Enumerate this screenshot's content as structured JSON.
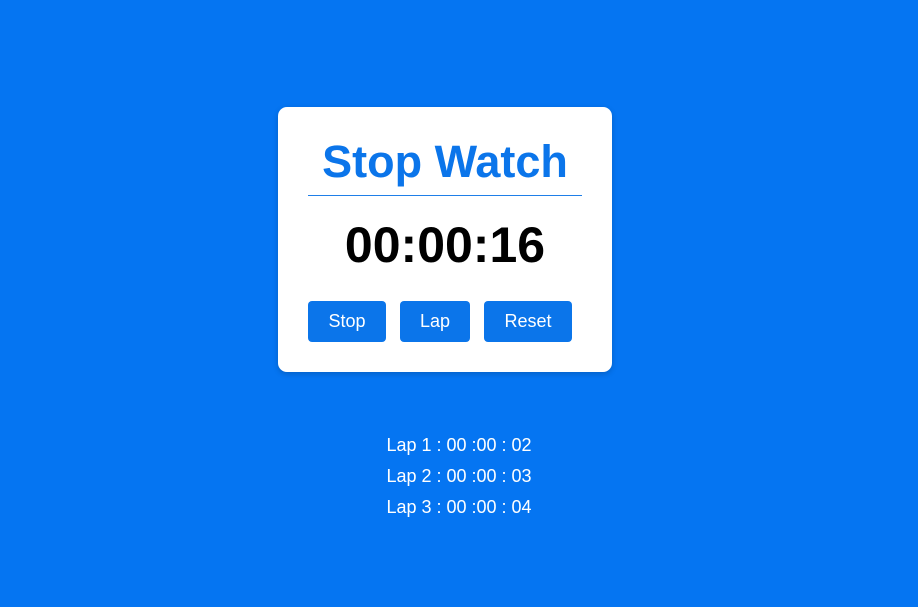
{
  "stopwatch": {
    "title": "Stop Watch",
    "time": "00:00:16",
    "buttons": {
      "stop": "Stop",
      "lap": "Lap",
      "reset": "Reset"
    }
  },
  "laps": [
    "Lap 1 : 00 :00 : 02",
    "Lap 2 : 00 :00 : 03",
    "Lap 3 : 00 :00 : 04"
  ],
  "colors": {
    "background": "#0575f2",
    "accent": "#0b75ea",
    "card": "#ffffff"
  }
}
